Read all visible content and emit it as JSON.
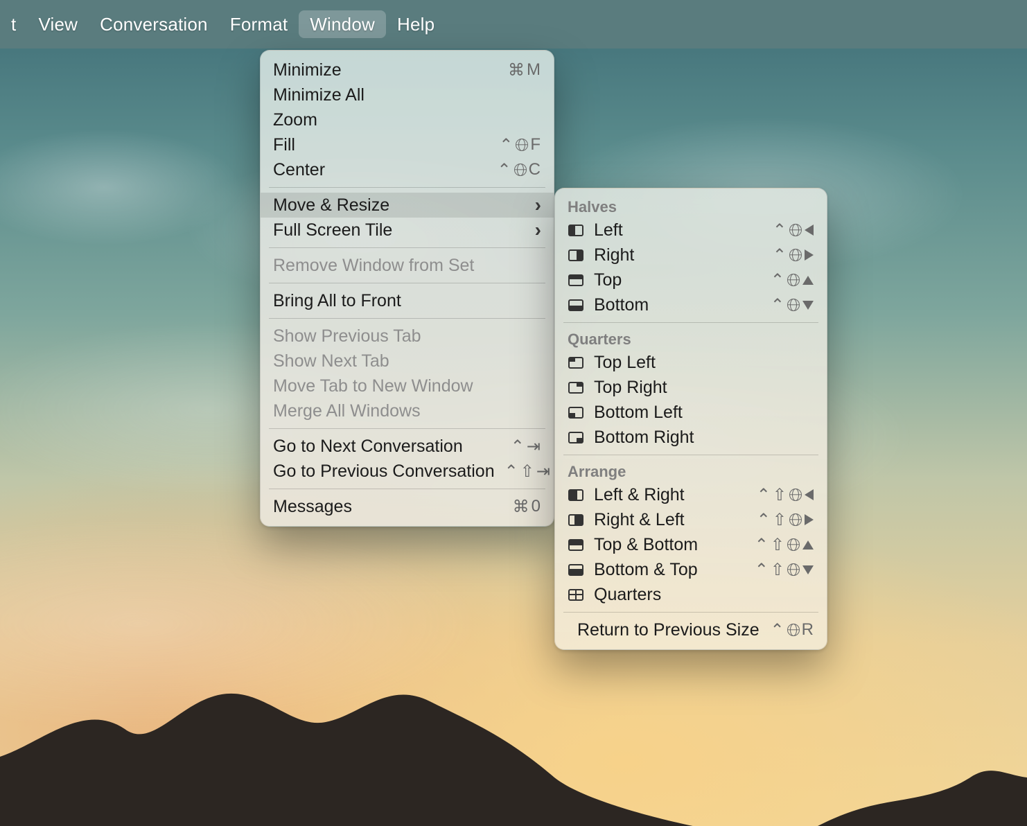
{
  "menubar": {
    "items": [
      {
        "label": "t"
      },
      {
        "label": "View"
      },
      {
        "label": "Conversation"
      },
      {
        "label": "Format"
      },
      {
        "label": "Window"
      },
      {
        "label": "Help"
      }
    ],
    "active_index": 4
  },
  "window_menu": {
    "groups": [
      {
        "type": "items",
        "items": [
          {
            "label": "Minimize",
            "shortcut": "⌘ M"
          },
          {
            "label": "Minimize All"
          },
          {
            "label": "Zoom"
          },
          {
            "label": "Fill",
            "shortcut": "^ 🌐 F"
          },
          {
            "label": "Center",
            "shortcut": "^ 🌐 C"
          }
        ]
      },
      {
        "type": "sep"
      },
      {
        "type": "items",
        "items": [
          {
            "label": "Move & Resize",
            "submenu": true,
            "hovered": true
          },
          {
            "label": "Full Screen Tile",
            "submenu": true
          }
        ]
      },
      {
        "type": "sep"
      },
      {
        "type": "items",
        "items": [
          {
            "label": "Remove Window from Set",
            "disabled": true
          }
        ]
      },
      {
        "type": "sep"
      },
      {
        "type": "items",
        "items": [
          {
            "label": "Bring All to Front"
          }
        ]
      },
      {
        "type": "sep"
      },
      {
        "type": "items",
        "items": [
          {
            "label": "Show Previous Tab",
            "disabled": true
          },
          {
            "label": "Show Next Tab",
            "disabled": true
          },
          {
            "label": "Move Tab to New Window",
            "disabled": true
          },
          {
            "label": "Merge All Windows",
            "disabled": true
          }
        ]
      },
      {
        "type": "sep"
      },
      {
        "type": "items",
        "items": [
          {
            "label": "Go to Next Conversation",
            "shortcut": "^ ⇥"
          },
          {
            "label": "Go to Previous Conversation",
            "shortcut": "^ ⇧ ⇥"
          }
        ]
      },
      {
        "type": "sep"
      },
      {
        "type": "items",
        "items": [
          {
            "label": "Messages",
            "shortcut": "⌘ 0"
          }
        ]
      }
    ]
  },
  "move_resize_menu": {
    "sections": [
      {
        "header": "Halves",
        "items": [
          {
            "icon": "left",
            "label": "Left",
            "shortcut": "^ 🌐 ◀"
          },
          {
            "icon": "right",
            "label": "Right",
            "shortcut": "^ 🌐 ▶"
          },
          {
            "icon": "top",
            "label": "Top",
            "shortcut": "^ 🌐 ▲"
          },
          {
            "icon": "bottom",
            "label": "Bottom",
            "shortcut": "^ 🌐 ▼"
          }
        ]
      },
      {
        "header": "Quarters",
        "items": [
          {
            "icon": "tl",
            "label": "Top Left"
          },
          {
            "icon": "tr",
            "label": "Top Right"
          },
          {
            "icon": "bl",
            "label": "Bottom Left"
          },
          {
            "icon": "br",
            "label": "Bottom Right"
          }
        ]
      },
      {
        "header": "Arrange",
        "items": [
          {
            "icon": "leftbig",
            "label": "Left & Right",
            "shortcut": "^ ⇧ 🌐 ◀"
          },
          {
            "icon": "rightbig",
            "label": "Right & Left",
            "shortcut": "^ ⇧ 🌐 ▶"
          },
          {
            "icon": "topbig",
            "label": "Top & Bottom",
            "shortcut": "^ ⇧ 🌐 ▲"
          },
          {
            "icon": "bottombig",
            "label": "Bottom & Top",
            "shortcut": "^ ⇧ 🌐 ▼"
          },
          {
            "icon": "grid",
            "label": "Quarters"
          }
        ]
      },
      {
        "footer_items": [
          {
            "label": "Return to Previous Size",
            "shortcut": "^ 🌐 R"
          }
        ]
      }
    ]
  }
}
